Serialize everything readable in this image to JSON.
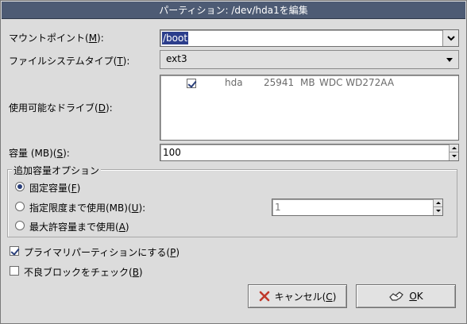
{
  "window": {
    "title": "パーティション: /dev/hda1を編集"
  },
  "mount_point": {
    "label_prefix": "マウントポイント(",
    "label_key": "M",
    "label_suffix": "):",
    "value": "/boot"
  },
  "fs_type": {
    "label_prefix": "ファイルシステムタイプ(",
    "label_key": "T",
    "label_suffix": "):",
    "value": "ext3"
  },
  "drives": {
    "label_prefix": "使用可能なドライブ(",
    "label_key": "D",
    "label_suffix": "):",
    "rows": [
      {
        "checked": true,
        "name": "hda",
        "size": "25941",
        "unit": "MB",
        "model": "WDC WD272AA"
      }
    ]
  },
  "size": {
    "label_prefix": "容量 (MB)(",
    "label_key": "S",
    "label_suffix": "):",
    "value": "100"
  },
  "options": {
    "title": "追加容量オプション",
    "fixed": {
      "prefix": "固定容量(",
      "key": "F",
      "suffix": ")",
      "selected": true
    },
    "limit": {
      "prefix": "指定限度まで使用(MB)(",
      "key": "U",
      "suffix": "):",
      "selected": false,
      "value": "1"
    },
    "max": {
      "prefix": "最大許容量まで使用(",
      "key": "A",
      "suffix": ")",
      "selected": false
    }
  },
  "primary": {
    "prefix": "プライマリパーティションにする(",
    "key": "P",
    "suffix": ")",
    "checked": true
  },
  "badblocks": {
    "prefix": "不良ブロックをチェック(",
    "key": "B",
    "suffix": ")",
    "checked": false
  },
  "buttons": {
    "cancel": {
      "prefix": "キャンセル(",
      "key": "C",
      "suffix": ")"
    },
    "ok": {
      "key": "O",
      "suffix": "K"
    }
  },
  "colors": {
    "titlebar": "#4d5b74",
    "selection": "#2c3e8c",
    "accent": "#2a3f7a",
    "cancel_icon": "#c0392b"
  }
}
